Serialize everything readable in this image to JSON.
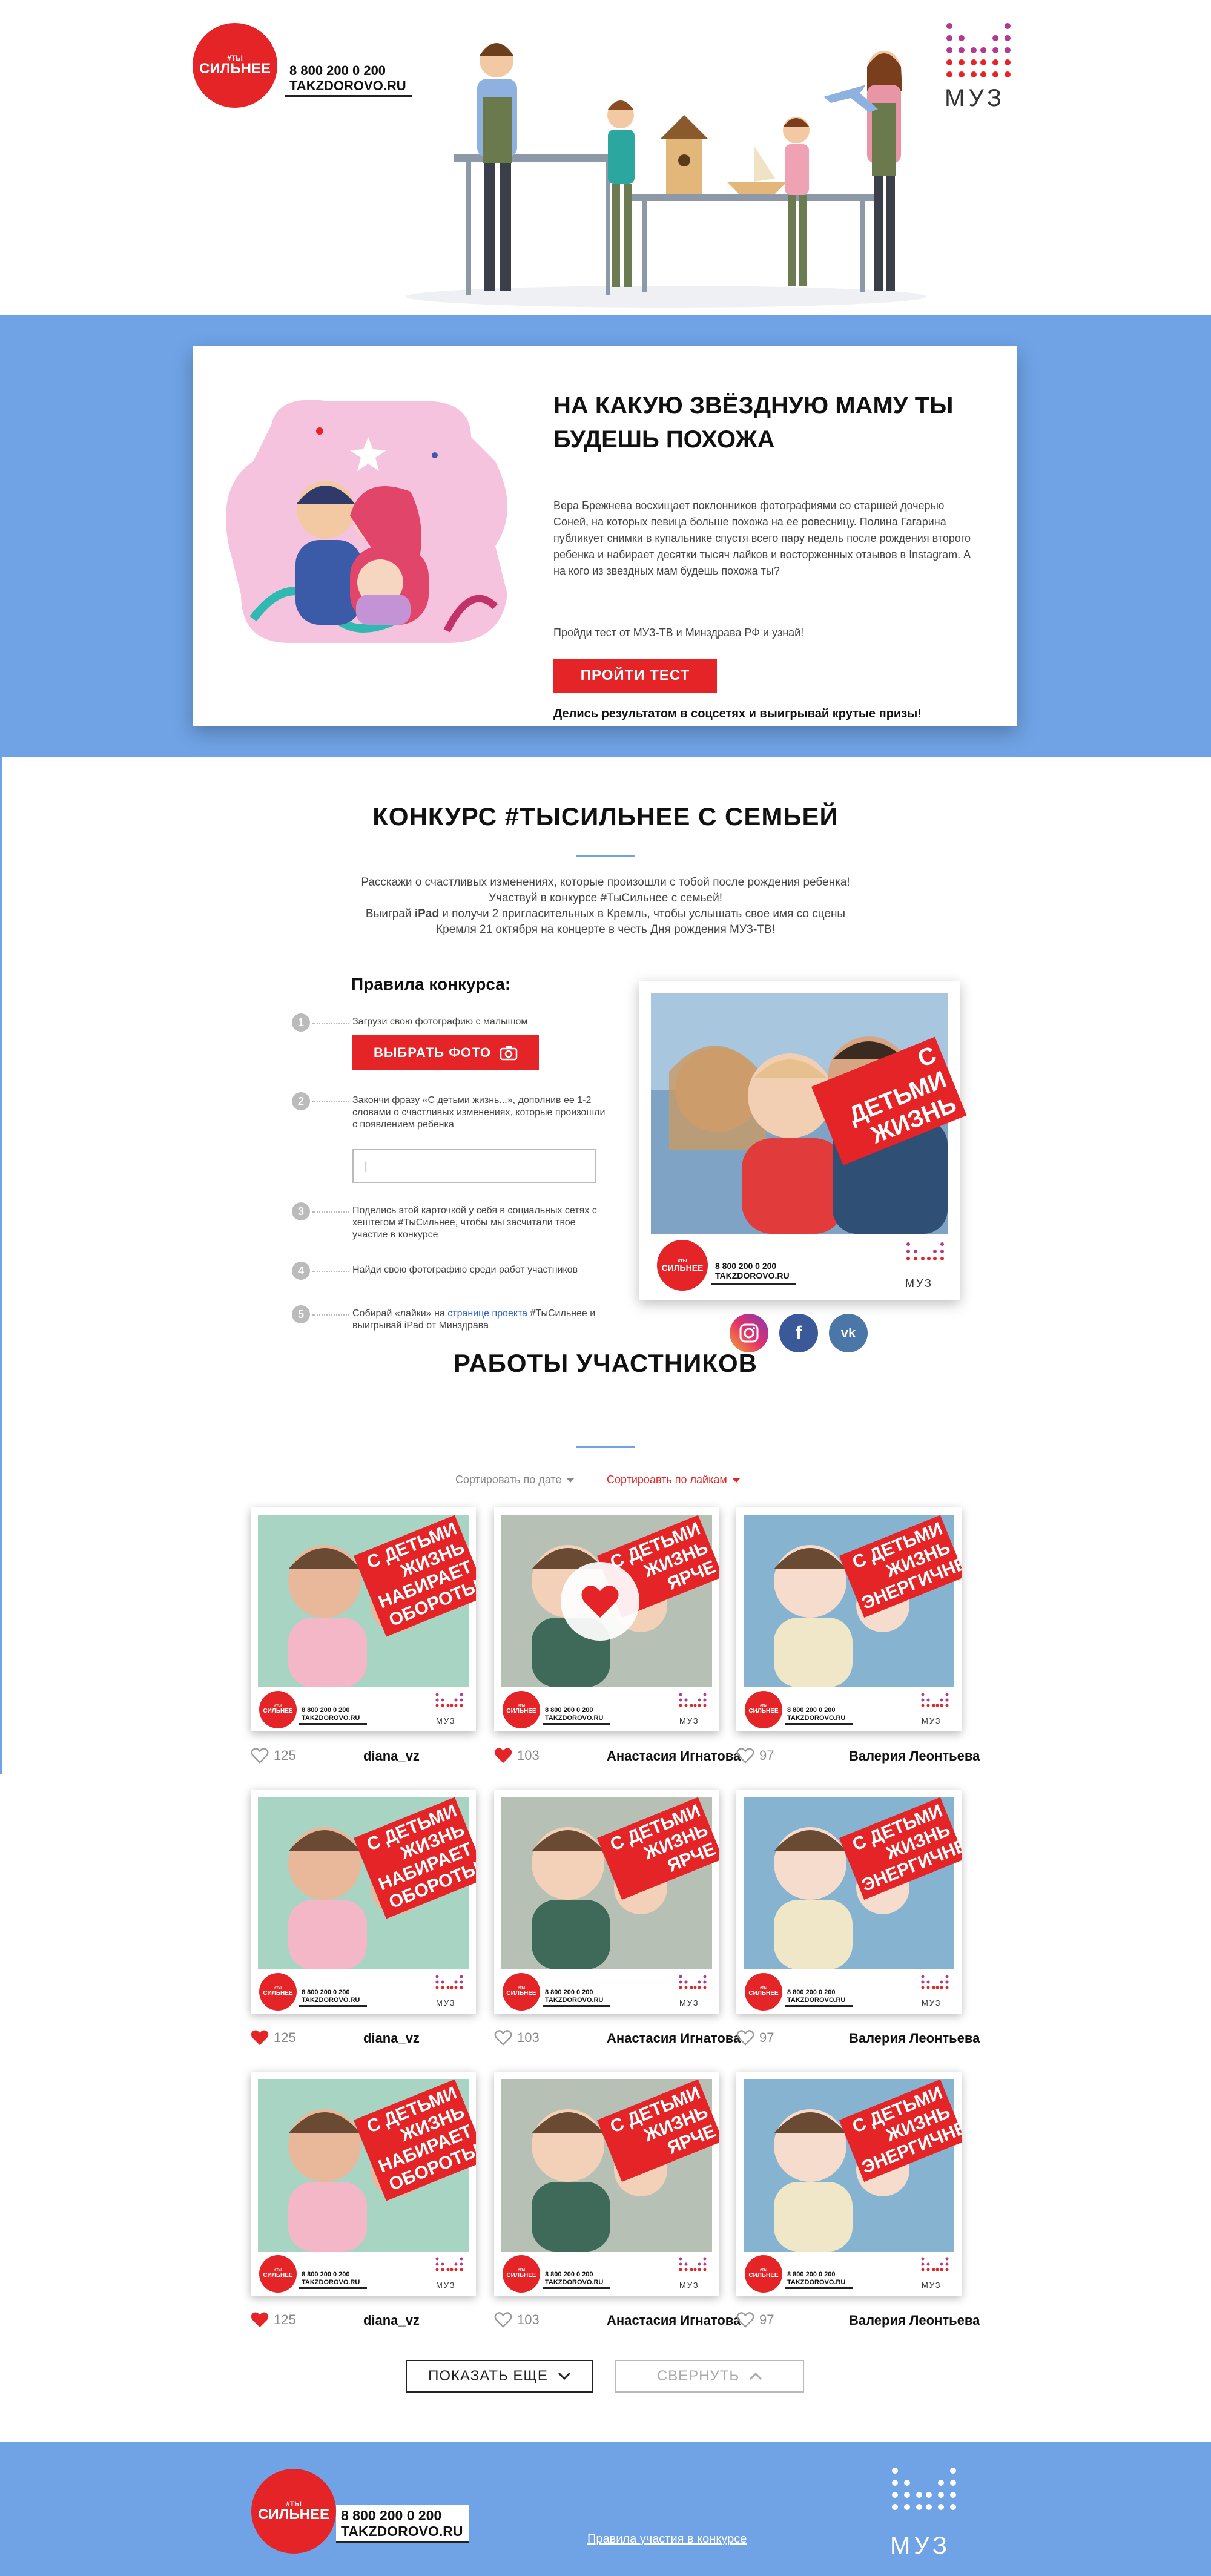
{
  "brand": {
    "badge_hash": "#ТЫ",
    "badge_word": "СИЛЬНЕЕ",
    "phone": "8 800 200 0 200",
    "site": "TAKZDOROVO.RU",
    "muz": "МУЗ"
  },
  "quiz": {
    "title": "НА КАКУЮ ЗВЁЗДНУЮ МАМУ ТЫ БУДЕШЬ ПОХОЖА",
    "text": "Вера Брежнева восхищает поклонников фотографиями со старшей дочерью Соней, на которых певица больше похожа на ее ровесницу. Полина Гагарина публикует снимки в купальнике спустя всего пару недель после рождения второго ребенка и набирает десятки тысяч лайков и восторженных отзывов в Instagram. А на кого из звездных мам будешь похожа ты?",
    "text2": "Пройди тест от МУЗ-ТВ и Минздрава РФ и узнай!",
    "button": "ПРОЙТИ ТЕСТ",
    "share": "Делись результатом в соцсетях и выигрывай крутые призы!"
  },
  "contest": {
    "title": "КОНКУРС #ТЫСИЛЬНЕЕ С СЕМЬЕЙ",
    "intro_1": "Расскажи о счастливых изменениях, которые произошли с тобой после рождения ребенка!",
    "intro_2": "Участвуй в конкурсе #ТыСильнее с семьей!",
    "intro_3a": "Выиграй ",
    "intro_3b": "iPad",
    "intro_3c": " и получи 2 пригласительных в Кремль, чтобы услышать свое имя со сцены",
    "intro_4": "Кремля 21 октября на концерте в честь Дня рождения МУЗ-ТВ!",
    "rules_title": "Правила конкурса:",
    "steps": [
      {
        "num": "1",
        "text": "Загрузи свою фотографию с малышом"
      },
      {
        "num": "2",
        "text": "Закончи фразу «С детьми жизнь...», дополнив ее 1-2 словами о счастливых изменениях, которые произошли с появлением ребенка"
      },
      {
        "num": "3",
        "text": "Поделись этой карточкой у себя в социальных сетях с хештегом #ТыСильнее, чтобы мы засчитали твое участие в конкурсе"
      },
      {
        "num": "4",
        "text": "Найди свою фотографию среди работ участников"
      },
      {
        "num": "5",
        "text_a": "Собирай «лайки» на ",
        "link": "странице проекта",
        "text_b": " #ТыСильнее и выигрывай iPad от Минздрава"
      }
    ],
    "choose_photo": "ВЫБРАТЬ ФОТО",
    "input_value": "|",
    "sample_banner": "С ДЕТЬМИ ЖИЗНЬ"
  },
  "works": {
    "title": "РАБОТЫ УЧАСТНИКОВ",
    "sort_date": "Сортировать по дате",
    "sort_likes": "Сортироавть по лайкам",
    "rows": [
      [
        {
          "banner": "С ДЕТЬМИ ЖИЗНЬ НАБИРАЕТ ОБОРОТЫ",
          "likes": "125",
          "name": "diana_vz",
          "liked": false
        },
        {
          "banner": "С ДЕТЬМИ ЖИЗНЬ ЯРЧЕ",
          "likes": "103",
          "name": "Анастасия Игнатова",
          "liked": true
        },
        {
          "banner": "С ДЕТЬМИ ЖИЗНЬ ЭНЕРГИЧНЕЙ",
          "likes": "97",
          "name": "Валерия Леонтьева",
          "liked": false
        }
      ],
      [
        {
          "banner": "С ДЕТЬМИ ЖИЗНЬ НАБИРАЕТ ОБОРОТЫ",
          "likes": "125",
          "name": "diana_vz",
          "liked": true
        },
        {
          "banner": "С ДЕТЬМИ ЖИЗНЬ ЯРЧЕ",
          "likes": "103",
          "name": "Анастасия Игнатова",
          "liked": false
        },
        {
          "banner": "С ДЕТЬМИ ЖИЗНЬ ЭНЕРГИЧНЕЙ",
          "likes": "97",
          "name": "Валерия Леонтьева",
          "liked": false
        }
      ],
      [
        {
          "banner": "С ДЕТЬМИ ЖИЗНЬ НАБИРАЕТ ОБОРОТЫ",
          "likes": "125",
          "name": "diana_vz",
          "liked": true
        },
        {
          "banner": "С ДЕТЬМИ ЖИЗНЬ ЯРЧЕ",
          "likes": "103",
          "name": "Анастасия Игнатова",
          "liked": false
        },
        {
          "banner": "С ДЕТЬМИ ЖИЗНЬ ЭНЕРГИЧНЕЙ",
          "likes": "97",
          "name": "Валерия Леонтьева",
          "liked": false
        }
      ]
    ],
    "show_more": "ПОКАЗАТЬ ЕЩЕ",
    "collapse": "СВЕРНУТЬ"
  },
  "footer": {
    "rules_link": "Правила участия в конкурсе"
  },
  "colors": {
    "accent_red": "#e52427",
    "band_blue": "#6fa3e6",
    "muz_purple": "#8e2a8b"
  },
  "icons": [
    "camera-icon",
    "heart-icon",
    "heart-outline-icon",
    "chevron-down-icon",
    "chevron-up-icon",
    "instagram-icon",
    "facebook-icon",
    "vk-icon"
  ]
}
